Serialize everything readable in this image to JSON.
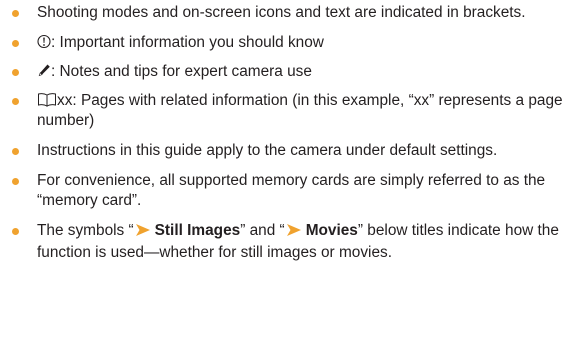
{
  "colors": {
    "bullet": "#f0a22e",
    "text": "#231f20",
    "arrow": "#f0a22e"
  },
  "items": [
    {
      "text": "Shooting modes and on-screen icons and text are indicated in brackets."
    },
    {
      "icon": "important-icon",
      "text": ": Important information you should know"
    },
    {
      "icon": "pencil-icon",
      "text": ": Notes and tips for expert camera use"
    },
    {
      "icon": "book-icon",
      "text": "xx: Pages with related information (in this example, “xx” represents a page number)"
    },
    {
      "text": "Instructions in this guide apply to the camera under default settings."
    },
    {
      "text": "For convenience, all supported memory cards are simply referred to as the “memory card”."
    },
    {
      "text_before": "The symbols “",
      "label_still": "Still Images",
      "text_middle": "” and “",
      "label_movies": "Movies",
      "text_after": "” below titles indicate how the function is used—whether for still images or movies.",
      "icon": "arrow-right-icon"
    }
  ]
}
